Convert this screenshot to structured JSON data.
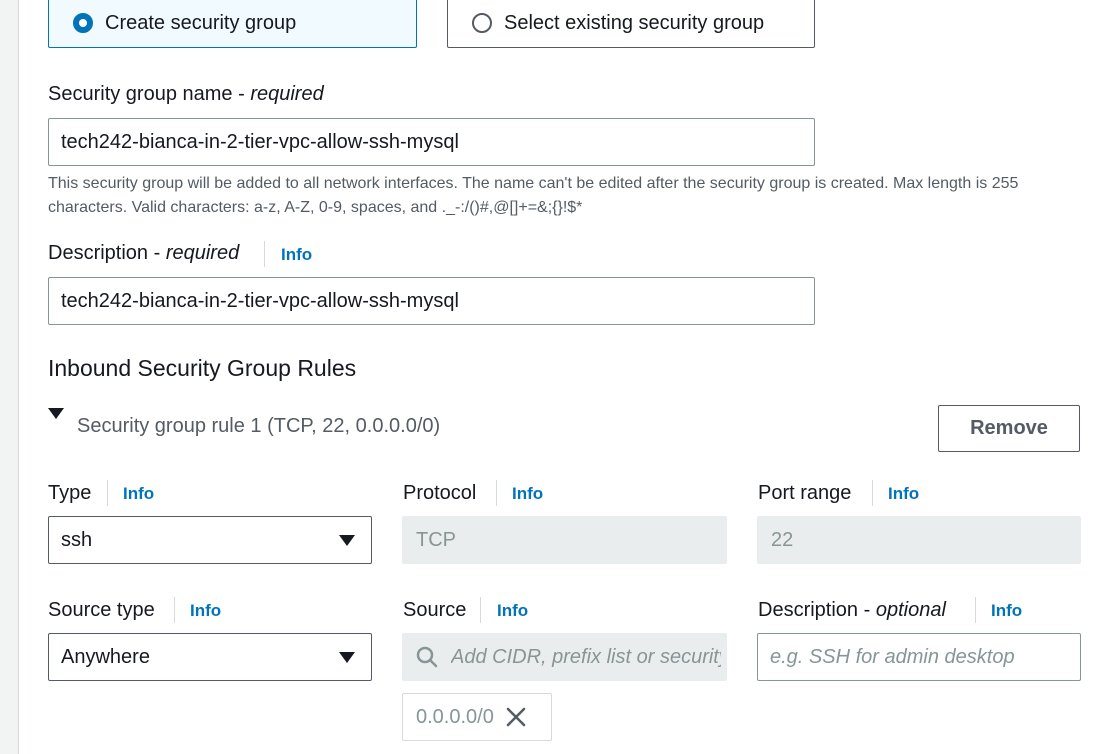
{
  "security_group_mode": {
    "create_label": "Create security group",
    "select_label": "Select existing security group",
    "selected": "create"
  },
  "name_field": {
    "label": "Security group name",
    "label_suffix": "required",
    "value": "tech242-bianca-in-2-tier-vpc-allow-ssh-mysql",
    "hint": "This security group will be added to all network interfaces. The name can't be edited after the security group is created. Max length is 255 characters. Valid characters: a-z, A-Z, 0-9, spaces, and ._-:/()#,@[]+=&;{}!$*"
  },
  "description_field": {
    "label": "Description",
    "label_suffix": "required",
    "info": "Info",
    "value": "tech242-bianca-in-2-tier-vpc-allow-ssh-mysql"
  },
  "inbound": {
    "heading": "Inbound Security Group Rules",
    "rule_title": "Security group rule 1 (TCP, 22, 0.0.0.0/0)",
    "remove_label": "Remove",
    "type": {
      "label": "Type",
      "info": "Info",
      "value": "ssh"
    },
    "protocol": {
      "label": "Protocol",
      "info": "Info",
      "value": "TCP"
    },
    "port_range": {
      "label": "Port range",
      "info": "Info",
      "value": "22"
    },
    "source_type": {
      "label": "Source type",
      "info": "Info",
      "value": "Anywhere"
    },
    "source": {
      "label": "Source",
      "info": "Info",
      "placeholder": "Add CIDR, prefix list or security group",
      "tokens": [
        "0.0.0.0/0"
      ]
    },
    "rule_description": {
      "label": "Description",
      "label_suffix": "optional",
      "info": "Info",
      "placeholder": "e.g. SSH for admin desktop"
    }
  },
  "colors": {
    "accent": "#0073bb",
    "selected_card_bg": "#f1faff",
    "disabled_bg": "#eaeded",
    "text": "#16191f",
    "muted": "#545b64"
  },
  "icons": [
    "radio-selected",
    "radio-unselected",
    "caret-down-icon",
    "search-icon",
    "close-icon"
  ]
}
